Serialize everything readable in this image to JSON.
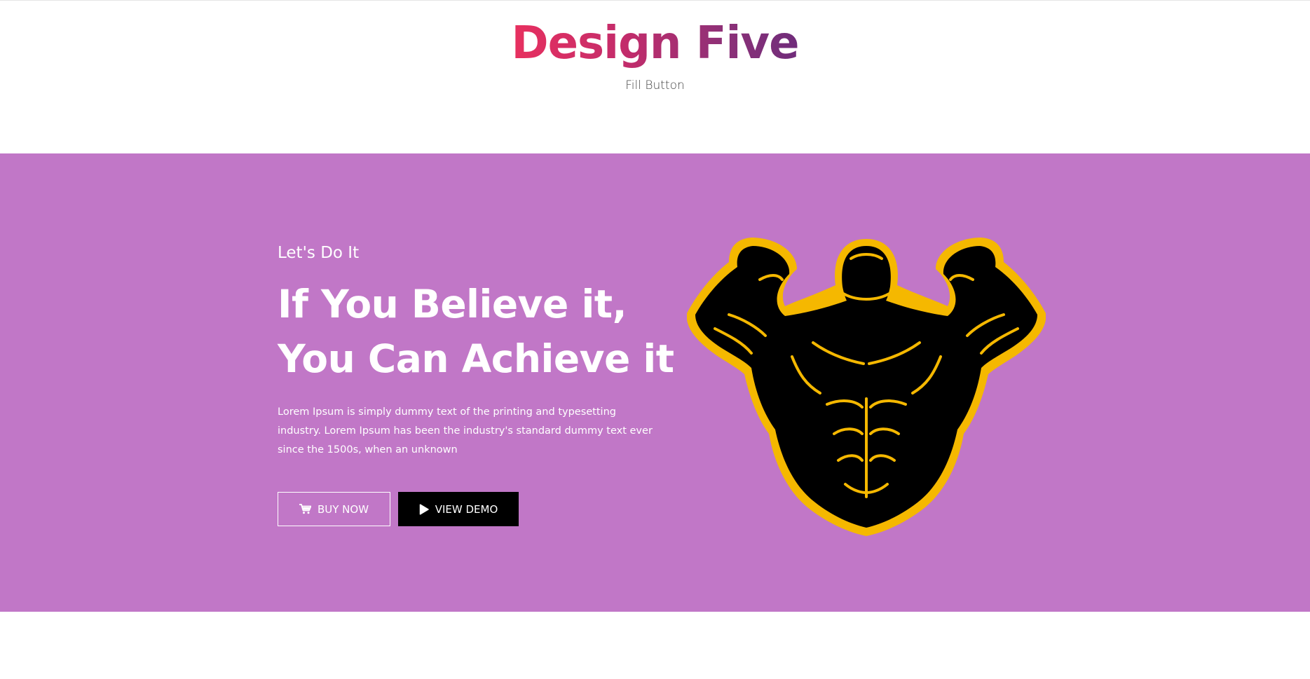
{
  "header": {
    "title": "Design Five",
    "subtitle": "Fill Button"
  },
  "hero": {
    "kicker": "Let's Do It",
    "headline_line1": "If You Believe it,",
    "headline_line2": "You Can Achieve it",
    "body": "Lorem Ipsum is simply dummy text of the printing and typesetting industry. Lorem Ipsum has been the industry's standard dummy text ever since the 1500s, when an unknown",
    "buttons": {
      "buy_now": {
        "label": "BUY NOW",
        "icon": "cart-icon"
      },
      "view_demo": {
        "label": "VIEW DEMO",
        "icon": "play-icon"
      }
    },
    "image": {
      "icon": "bodybuilder-mascot-icon"
    }
  },
  "colors": {
    "title_gradient_start": "#e8305f",
    "title_gradient_end": "#6f2c7a",
    "hero_background": "#c177c7",
    "mascot_outline": "#f5b800",
    "mascot_fill": "#000000"
  }
}
